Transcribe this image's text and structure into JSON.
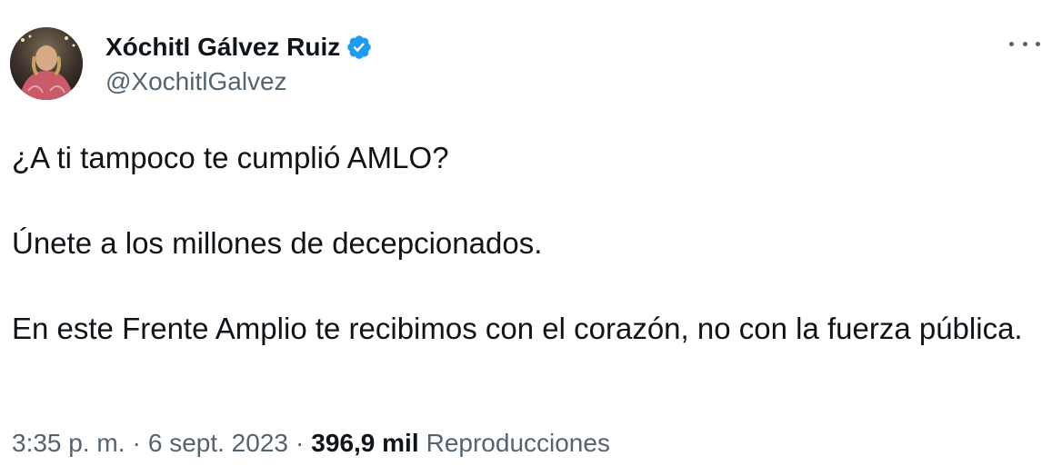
{
  "author": {
    "display_name": "Xóchitl Gálvez Ruiz",
    "handle": "@XochitlGalvez",
    "verified": true,
    "verified_color": "#1d9bf0"
  },
  "tweet": {
    "paragraphs": [
      "¿A ti tampoco te cumplió AMLO?",
      "Únete a los millones de decepcionados.",
      "En este Frente Amplio te recibimos con el corazón, no con la fuerza pública."
    ]
  },
  "meta": {
    "time": "3:35 p. m.",
    "separator": "·",
    "date": "6 sept. 2023",
    "views_count": "396,9 mil",
    "views_label": "Reproducciones"
  },
  "icons": {
    "more": "more-dots-icon",
    "verified": "verified-badge-icon"
  },
  "colors": {
    "text_primary": "#0f1419",
    "text_secondary": "#536471",
    "background": "#ffffff"
  }
}
